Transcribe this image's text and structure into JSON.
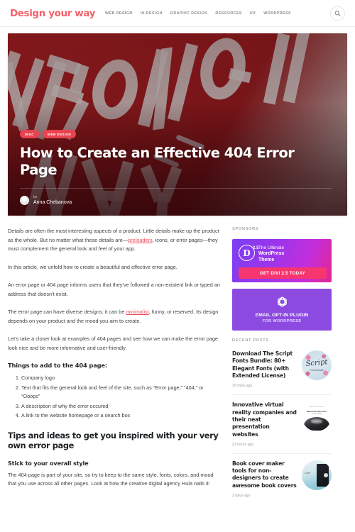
{
  "header": {
    "logo": "Design your way",
    "nav": [
      {
        "label": "WEB DESIGN"
      },
      {
        "label": "UI DESIGN"
      },
      {
        "label": "GRAPHIC DESIGN"
      },
      {
        "label": "RESOURCES"
      },
      {
        "label": "UX"
      },
      {
        "label": "WORDPRESS"
      }
    ],
    "search_icon": "search-icon",
    "accent_color": "#f4616a"
  },
  "hero": {
    "tags": [
      {
        "label": "MISC"
      },
      {
        "label": "WEB DESIGN"
      }
    ],
    "title": "How to Create an Effective 404 Error Page",
    "by_label": "by",
    "author": "Anna Chebanova",
    "image_alt": "WRONG WAY road sign",
    "image_colors": {
      "sign_red": "#8c1a1d",
      "letters_grey": "#c6c8c7"
    }
  },
  "article": {
    "paragraphs": [
      {
        "pre": "Details are often the most interesting aspects of a product. Little details make up the product as the whole. But no matter what these details are—",
        "link": "preloaders",
        "post": ", icons, or error pages—they must complement the general look and feel of your app."
      },
      {
        "pre": "In this article, we unfold how to create a beautiful and effective error page.",
        "link": "",
        "post": ""
      },
      {
        "pre": "An error page or 404 page informs users that they’ve followed a non-existent link or typed an address that doesn’t exist.",
        "link": "",
        "post": ""
      },
      {
        "pre": "The error page can have diverse designs: it can be ",
        "link": "minimalist",
        "post": ", funny, or reserved. Its design depends on your product and the mood you aim to create."
      },
      {
        "pre": "Let’s take a closer look at examples of 404 pages and see how we can make the error page look nice and be more informative and user-friendly.",
        "link": "",
        "post": ""
      }
    ],
    "list_heading": "Things to add to the 404 page:",
    "list_items": [
      {
        "text": "Company logo"
      },
      {
        "text": "Text that fits the general look and feel of the site, such as “Error page,” “404,” or “Ooops”"
      },
      {
        "text": "A description of why the error occured"
      },
      {
        "text": "A link to the website homepage or a search box"
      }
    ],
    "section_heading": "Tips and ideas to get you inspired with your very own error page",
    "sub_heading": "Stick to your overall style",
    "closing_paragraph": "The 404 page is part of your site, so try to keep to the same style, fonts, colors, and mood that you use across all other pages. Look at how the creative digital agency Hula nails it:"
  },
  "sidebar": {
    "sponsors_heading": "SPONSORS",
    "ads": [
      {
        "name": "divi",
        "logo_letter": "D",
        "version": "2.5",
        "line1": "The Ultimate",
        "line2": "WordPress",
        "line3": "Theme",
        "cta": "GET DIVI 2.5 TODAY",
        "cta_color": "#f7356e"
      },
      {
        "name": "email-optin",
        "line1": "EMAIL OPT-IN PLUGIN",
        "line2": "FOR WORDPRESS",
        "bg_color": "#8c4ae0"
      }
    ],
    "recent_heading": "RECENT POSTS",
    "recent_posts": [
      {
        "title": "Download The Script Fonts Bundle: 80+ Elegant Fonts (with Extended License)",
        "time": "10 mins ago",
        "thumb": "script-fonts-thumbnail",
        "thumb_script": "Script",
        "thumb_sub": "Fonts Bundle"
      },
      {
        "title": "Innovative virtual reality companies and their neat presentation websites",
        "time": "23 hours ago",
        "thumb": "vr-headset-thumbnail",
        "thumb_t1": "Microsoft HoloLens",
        "thumb_t2": "mixed reality"
      },
      {
        "title": "Book cover maker tools for non-designers to create awesome book covers",
        "time": "2 days ago",
        "thumb": "book-cover-thumbnail",
        "thumb_label": "Cover"
      }
    ]
  }
}
